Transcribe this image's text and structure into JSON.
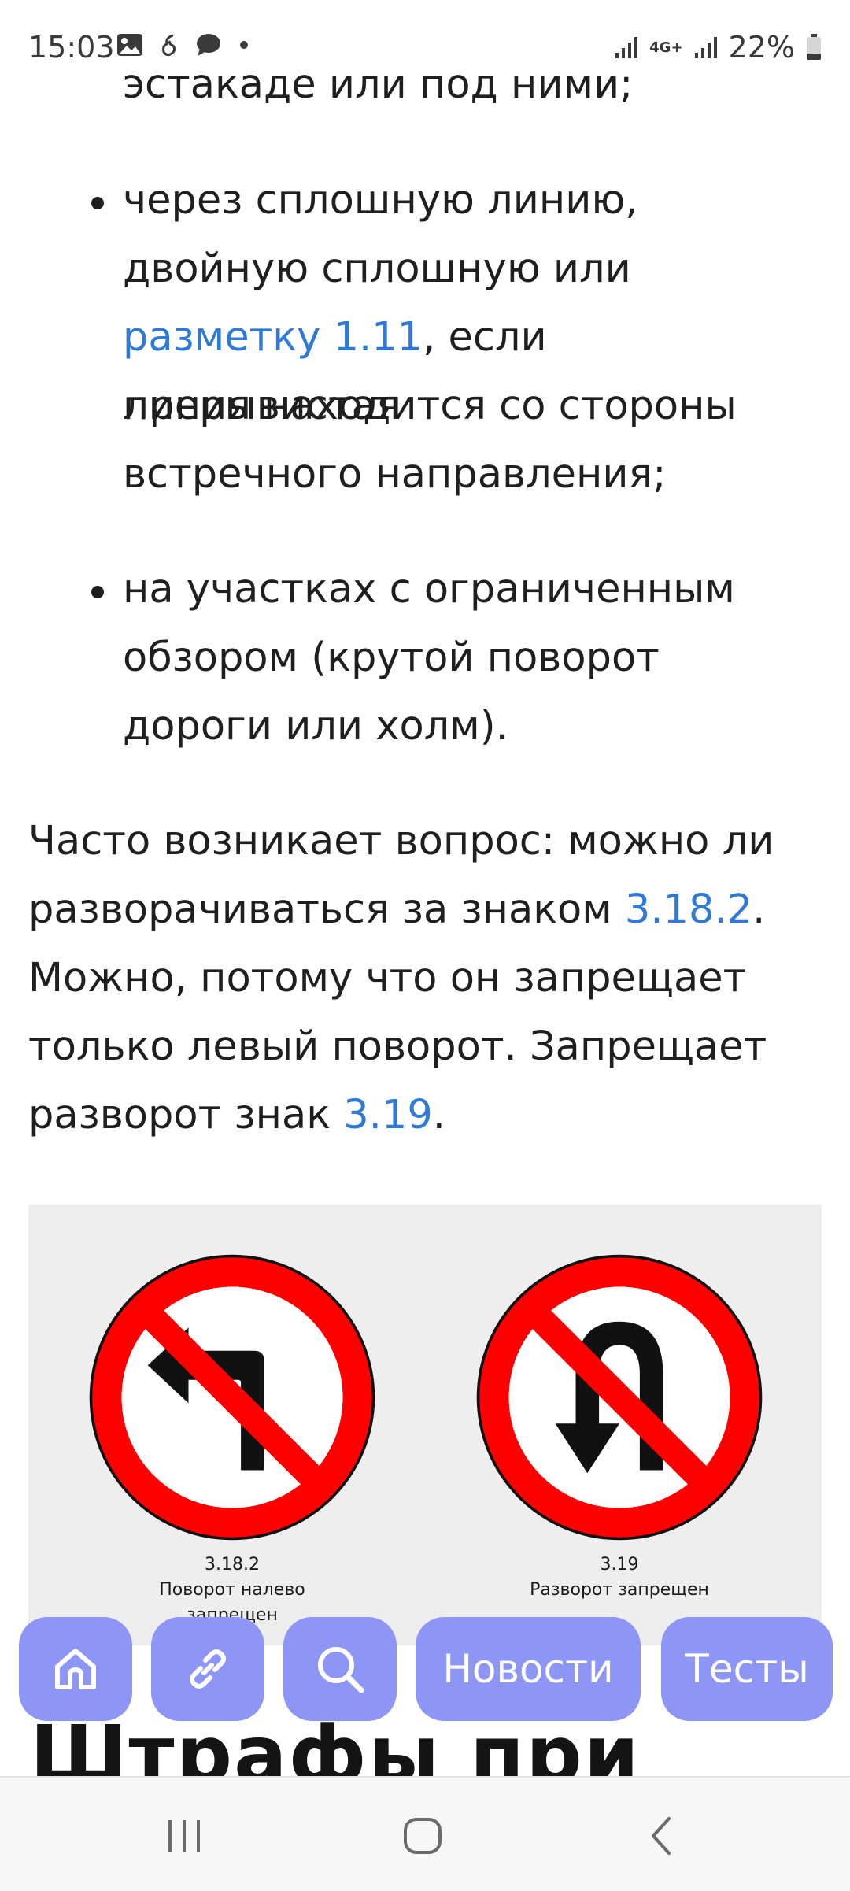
{
  "status_bar": {
    "time": "15:03",
    "network": "4G+",
    "battery": "22%"
  },
  "article": {
    "bullet0_tail": "эстакаде или под ними;",
    "bullet1": {
      "line1": "через сплошную линию,",
      "line2": "двойную сплошную или",
      "link": "разметку 1.11",
      "line3_rest": ", если прерывистая",
      "line4": "линия находится со стороны",
      "line5": "встречного направления;"
    },
    "bullet2": {
      "line1": "на участках с ограниченным",
      "line2": "обзором (крутой поворот",
      "line3": "дороги или холм)."
    },
    "paragraph": {
      "line1": "Часто возникает вопрос: можно ли",
      "line2_pre": "разворачиваться за знаком ",
      "link1": "3.18.2",
      "line2_post": ".",
      "line3": "Можно, потому что он запрещает",
      "line4": "только левый поворот. Запрещает",
      "line5_pre": "разворот знак ",
      "link2": "3.19",
      "line5_post": "."
    },
    "figure": {
      "sign1": {
        "code": "3.18.2",
        "line1": "Поворот налево",
        "line2": "запрещен"
      },
      "sign2": {
        "code": "3.19",
        "line1": "Разворот запрещен"
      }
    },
    "heading": "Штрафы при"
  },
  "buttons": {
    "home_icon": "home-icon",
    "link_icon": "link-icon",
    "search_icon": "search-icon",
    "news": "Новости",
    "tests": "Тесты"
  },
  "colors": {
    "link": "#2f7ad6",
    "fab": "#8d95f5",
    "sign_red": "#ff0000"
  }
}
